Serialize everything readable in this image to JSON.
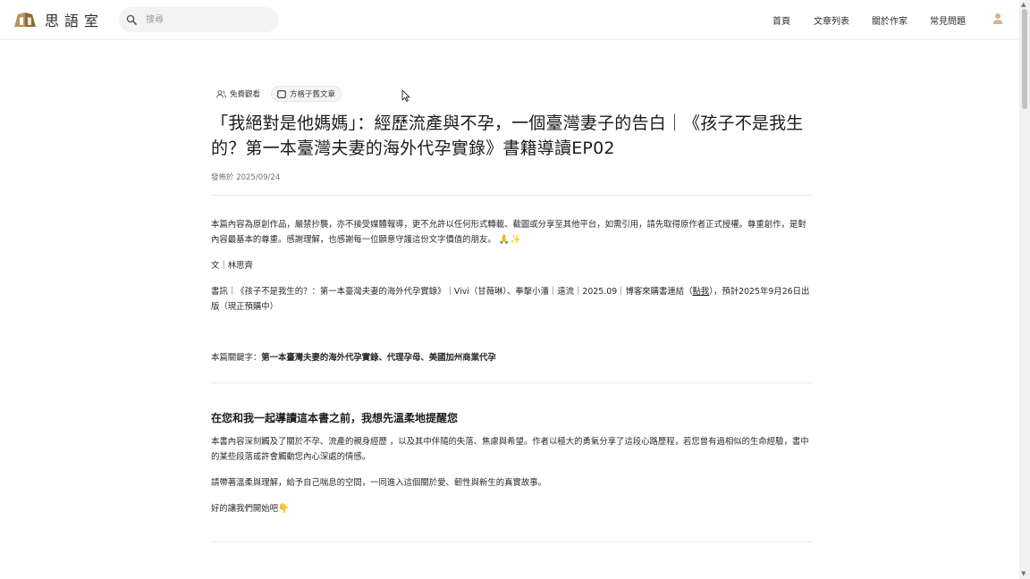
{
  "header": {
    "logo_text": "思語室",
    "search_placeholder": "搜尋",
    "nav": [
      "首頁",
      "文章列表",
      "關於作家",
      "常見問題"
    ]
  },
  "article": {
    "tags": [
      "免費觀看",
      "方格子舊文章"
    ],
    "title": "「我絕對是他媽媽」：經歷流產與不孕，一個臺灣妻子的告白｜《孩子不是我生的？第一本臺灣夫妻的海外代孕實錄》書籍導讀EP02",
    "date": "發佈於 2025/09/24",
    "copyright": "本篇內容為原創作品，嚴禁抄襲，亦不接受媒體報導，更不允許以任何形式轉載、截圖或分享至其他平台，如需引用，請先取得原作者正式授權。尊重創作，是對內容最基本的尊重。感謝理解，也感謝每一位願意守護這份文字價值的朋友。",
    "copyright_emoji": "🙏✨",
    "author": "文｜林思齊",
    "book_info_before": "書訊｜《孩子不是我生的？：第一本臺灣夫妻的海外代孕實錄》｜Vivi（甘薇琳）、拳擊小潘｜遠流｜2025.09｜博客來購書連結（",
    "book_info_link": "點我",
    "book_info_after": "），預計2025年9月26日出版（現正預購中）",
    "keywords_label": "本篇關鍵字：",
    "keywords": "第一本臺灣夫妻的海外代孕實錄、代理孕母、美國加州商業代孕",
    "section_title": "在您和我一起導讀這本書之前，我想先溫柔地提醒您",
    "para1": "本書內容深刻觸及了關於不孕、流產的親身經歷 ，以及其中伴隨的失落、焦慮與希望。作者以極大的勇氣分享了這段心路歷程，若您曾有過相似的生命經驗，書中的某些段落或許會觸動您內心深處的情感。",
    "para2": "請帶著溫柔與理解，給予自己喘息的空間，一同進入這個關於愛、韌性與新生的真實故事。",
    "para3": "好的讓我們開始吧",
    "para3_emoji": "👇"
  }
}
